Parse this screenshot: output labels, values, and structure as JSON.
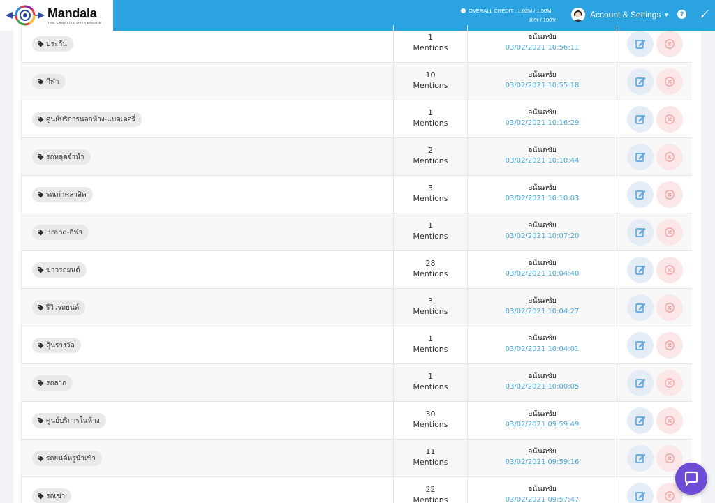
{
  "header": {
    "brand_name": "Mandala",
    "brand_tagline": "THE CREATIVE DATA ENGINE",
    "credit_label": "OVERALL CREDIT : 1.02M / 1.50M",
    "credit_percent": "68% / 100%",
    "account_label": "Account & Settings",
    "help_label": "?"
  },
  "rows": [
    {
      "tag": "ประกัน",
      "count": "1",
      "mentions": "Mentions",
      "user": "อนันตชัย",
      "date": "03/02/2021 10:56:11"
    },
    {
      "tag": "กีฬา",
      "count": "10",
      "mentions": "Mentions",
      "user": "อนันตชัย",
      "date": "03/02/2021 10:55:18"
    },
    {
      "tag": "ศูนย์บริการนอกห้าง-แบตเตอรี่",
      "count": "1",
      "mentions": "Mentions",
      "user": "อนันตชัย",
      "date": "03/02/2021 10:16:29"
    },
    {
      "tag": "รถหลุดจำนำ",
      "count": "2",
      "mentions": "Mentions",
      "user": "อนันตชัย",
      "date": "03/02/2021 10:10:44"
    },
    {
      "tag": "รถเก่าคลาสิค",
      "count": "3",
      "mentions": "Mentions",
      "user": "อนันตชัย",
      "date": "03/02/2021 10:10:03"
    },
    {
      "tag": "Brand-กีฬา",
      "count": "1",
      "mentions": "Mentions",
      "user": "อนันตชัย",
      "date": "03/02/2021 10:07:20"
    },
    {
      "tag": "ข่าวรถยนต์",
      "count": "28",
      "mentions": "Mentions",
      "user": "อนันตชัย",
      "date": "03/02/2021 10:04:40"
    },
    {
      "tag": "รีวิวรถยนต์",
      "count": "3",
      "mentions": "Mentions",
      "user": "อนันตชัย",
      "date": "03/02/2021 10:04:27"
    },
    {
      "tag": "ลุ้นรางวัล",
      "count": "1",
      "mentions": "Mentions",
      "user": "อนันตชัย",
      "date": "03/02/2021 10:04:01"
    },
    {
      "tag": "รถลาก",
      "count": "1",
      "mentions": "Mentions",
      "user": "อนันตชัย",
      "date": "03/02/2021 10:00:05"
    },
    {
      "tag": "ศูนย์บริการในห้าง",
      "count": "30",
      "mentions": "Mentions",
      "user": "อนันตชัย",
      "date": "03/02/2021 09:59:49"
    },
    {
      "tag": "รถยนต์หรูนำเข้า",
      "count": "11",
      "mentions": "Mentions",
      "user": "อนันตชัย",
      "date": "03/02/2021 09:59:16"
    },
    {
      "tag": "รถเช่า",
      "count": "22",
      "mentions": "Mentions",
      "user": "อนันตชัย",
      "date": "03/02/2021 09:57:47"
    }
  ],
  "icons": {
    "tag": "tag-icon",
    "edit": "edit-icon",
    "delete": "close-circle-icon",
    "chat": "chat-bubble-icon",
    "help": "help-icon",
    "brush": "brush-icon"
  },
  "colors": {
    "topbar": "#2aa3e0",
    "date_text": "#43a7dc",
    "edit_bg": "#e4edf5",
    "delete_bg": "#fbe7e7",
    "chat": "#6d4dd6"
  }
}
